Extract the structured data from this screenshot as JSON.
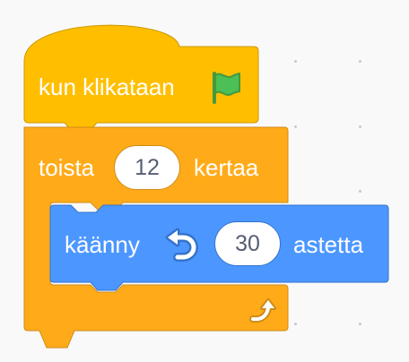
{
  "colors": {
    "workspace": "#f9f9f9",
    "events": "#ffbf00",
    "events_border": "#cc9900",
    "control": "#ffab19",
    "control_border": "#cf8b17",
    "motion": "#4c97ff",
    "motion_border": "#3373cc",
    "flag_green": "#4cbf56",
    "input_text": "#575e75"
  },
  "blocks": {
    "when_flag_clicked": {
      "label": "kun klikataan",
      "icon": "green-flag-icon"
    },
    "repeat": {
      "label_before": "toista",
      "count": "12",
      "label_after": "kertaa",
      "loop_icon": "loop-arrow-icon"
    },
    "turn_left": {
      "label_before": "käänny",
      "icon": "rotate-left-icon",
      "degrees": "30",
      "label_after": "astetta"
    }
  }
}
